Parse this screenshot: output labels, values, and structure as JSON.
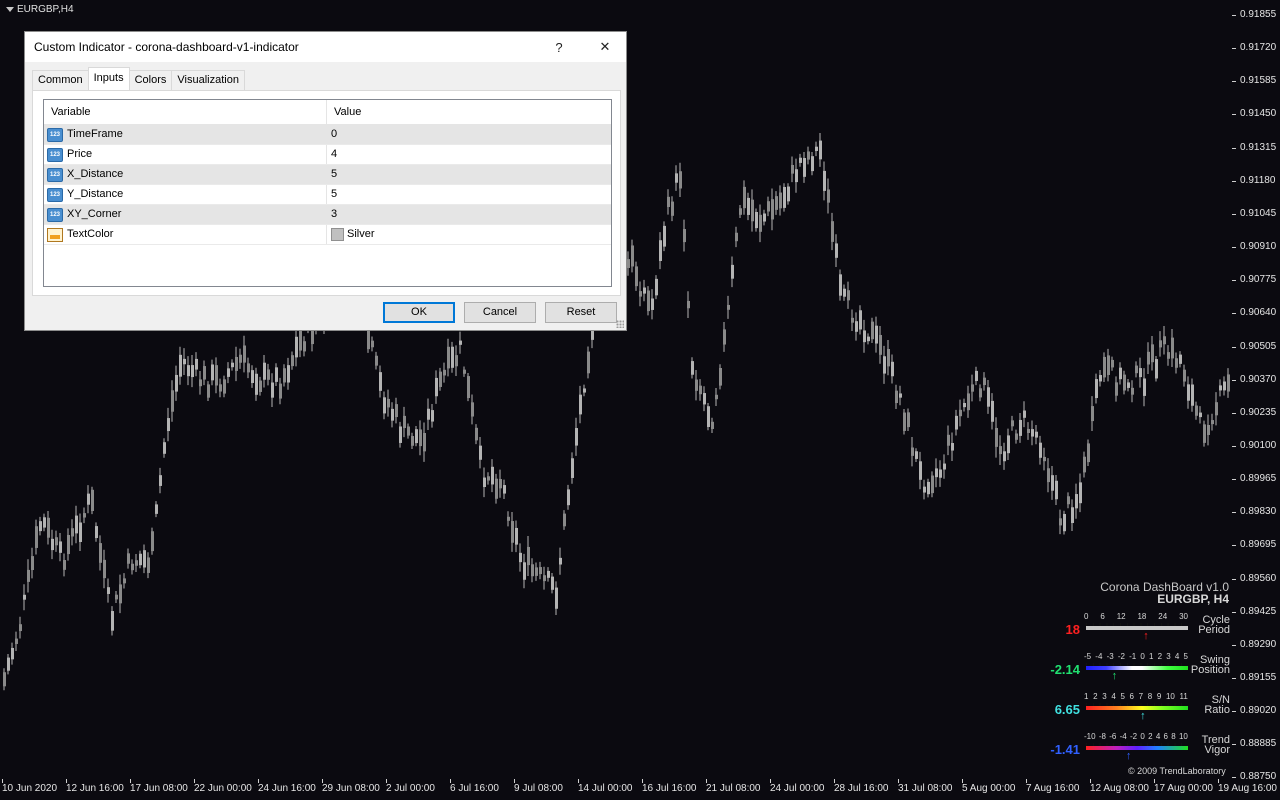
{
  "chart": {
    "symbol_title": "EURGBP,H4",
    "price_labels": [
      "0.91855",
      "0.91720",
      "0.91585",
      "0.91450",
      "0.91315",
      "0.91180",
      "0.91045",
      "0.90910",
      "0.90775",
      "0.90640",
      "0.90505",
      "0.90370",
      "0.90235",
      "0.90100",
      "0.89965",
      "0.89830",
      "0.89695",
      "0.89560",
      "0.89425",
      "0.89290",
      "0.89155",
      "0.89020",
      "0.88885",
      "0.88750"
    ],
    "time_labels": [
      "10 Jun 2020",
      "12 Jun 16:00",
      "17 Jun 08:00",
      "22 Jun 00:00",
      "24 Jun 16:00",
      "29 Jun 08:00",
      "2 Jul 00:00",
      "6 Jul 16:00",
      "9 Jul 08:00",
      "14 Jul 00:00",
      "16 Jul 16:00",
      "21 Jul 08:00",
      "24 Jul 00:00",
      "28 Jul 16:00",
      "31 Jul 08:00",
      "5 Aug 00:00",
      "7 Aug 16:00",
      "12 Aug 08:00",
      "17 Aug 00:00",
      "19 Aug 16:00"
    ],
    "colors": {
      "background": "#0b0a10",
      "candle": "#b4b4b4"
    }
  },
  "dashboard": {
    "title": "Corona DashBoard v1.0",
    "symbol": "EURGBP, H4",
    "copyright": "© 2009 TrendLaboratory",
    "rows": [
      {
        "value": "18",
        "value_color": "#ff2020",
        "ticks": [
          "0",
          "6",
          "12",
          "18",
          "24",
          "30"
        ],
        "label1": "Cycle",
        "label2": "Period",
        "arrow_color": "#ff2020",
        "arrow_fraction": 0.6,
        "bar_gradient": "linear-gradient(90deg,#c8c8c8,#c8c8c8)"
      },
      {
        "value": "-2.14",
        "value_color": "#20e070",
        "ticks": [
          "-5",
          "-4",
          "-3",
          "-2",
          "-1",
          "0",
          "1",
          "2",
          "3",
          "4",
          "5"
        ],
        "label1": "Swing",
        "label2": "Position",
        "arrow_color": "#20e070",
        "arrow_fraction": 0.29,
        "bar_gradient": "linear-gradient(90deg,#2020ff 0%,#4040ff 20%,#ffffff 45%,#ffffff 55%,#40ff40 80%,#20e020 100%)"
      },
      {
        "value": "6.65",
        "value_color": "#40e0e0",
        "ticks": [
          "1",
          "2",
          "3",
          "4",
          "5",
          "6",
          "7",
          "8",
          "9",
          "10",
          "11"
        ],
        "label1": "S/N",
        "label2": "Ratio",
        "arrow_color": "#40e0e0",
        "arrow_fraction": 0.57,
        "bar_gradient": "linear-gradient(90deg,#ff2020 0%,#ff8020 30%,#ffff20 55%,#80ff20 75%,#20e020 100%)"
      },
      {
        "value": "-1.41",
        "value_color": "#3060ff",
        "ticks": [
          "-10",
          "-8",
          "-6",
          "-4",
          "-2",
          "0",
          "2",
          "4",
          "6",
          "8",
          "10"
        ],
        "label1": "Trend",
        "label2": "Vigor",
        "arrow_color": "#3060ff",
        "arrow_fraction": 0.43,
        "bar_gradient": "linear-gradient(90deg,#ff2020 0%,#c020c0 30%,#6020ff 50%,#2080ff 70%,#20e020 100%)"
      }
    ]
  },
  "dialog": {
    "title": "Custom Indicator - corona-dashboard-v1-indicator",
    "help_label": "?",
    "close_label": "✕",
    "tabs": [
      "Common",
      "Inputs",
      "Colors",
      "Visualization"
    ],
    "active_tab": "Inputs",
    "grid": {
      "headers": [
        "Variable",
        "Value"
      ],
      "rows": [
        {
          "icon": "123",
          "variable": "TimeFrame",
          "value": "0"
        },
        {
          "icon": "123",
          "variable": "Price",
          "value": "4"
        },
        {
          "icon": "123",
          "variable": "X_Distance",
          "value": "5"
        },
        {
          "icon": "123",
          "variable": "Y_Distance",
          "value": "5"
        },
        {
          "icon": "123",
          "variable": "XY_Corner",
          "value": "3"
        },
        {
          "icon": "color",
          "variable": "TextColor",
          "value": "Silver",
          "swatch": "#c0c0c0"
        }
      ]
    },
    "buttons": {
      "ok": "OK",
      "cancel": "Cancel",
      "reset": "Reset"
    }
  }
}
